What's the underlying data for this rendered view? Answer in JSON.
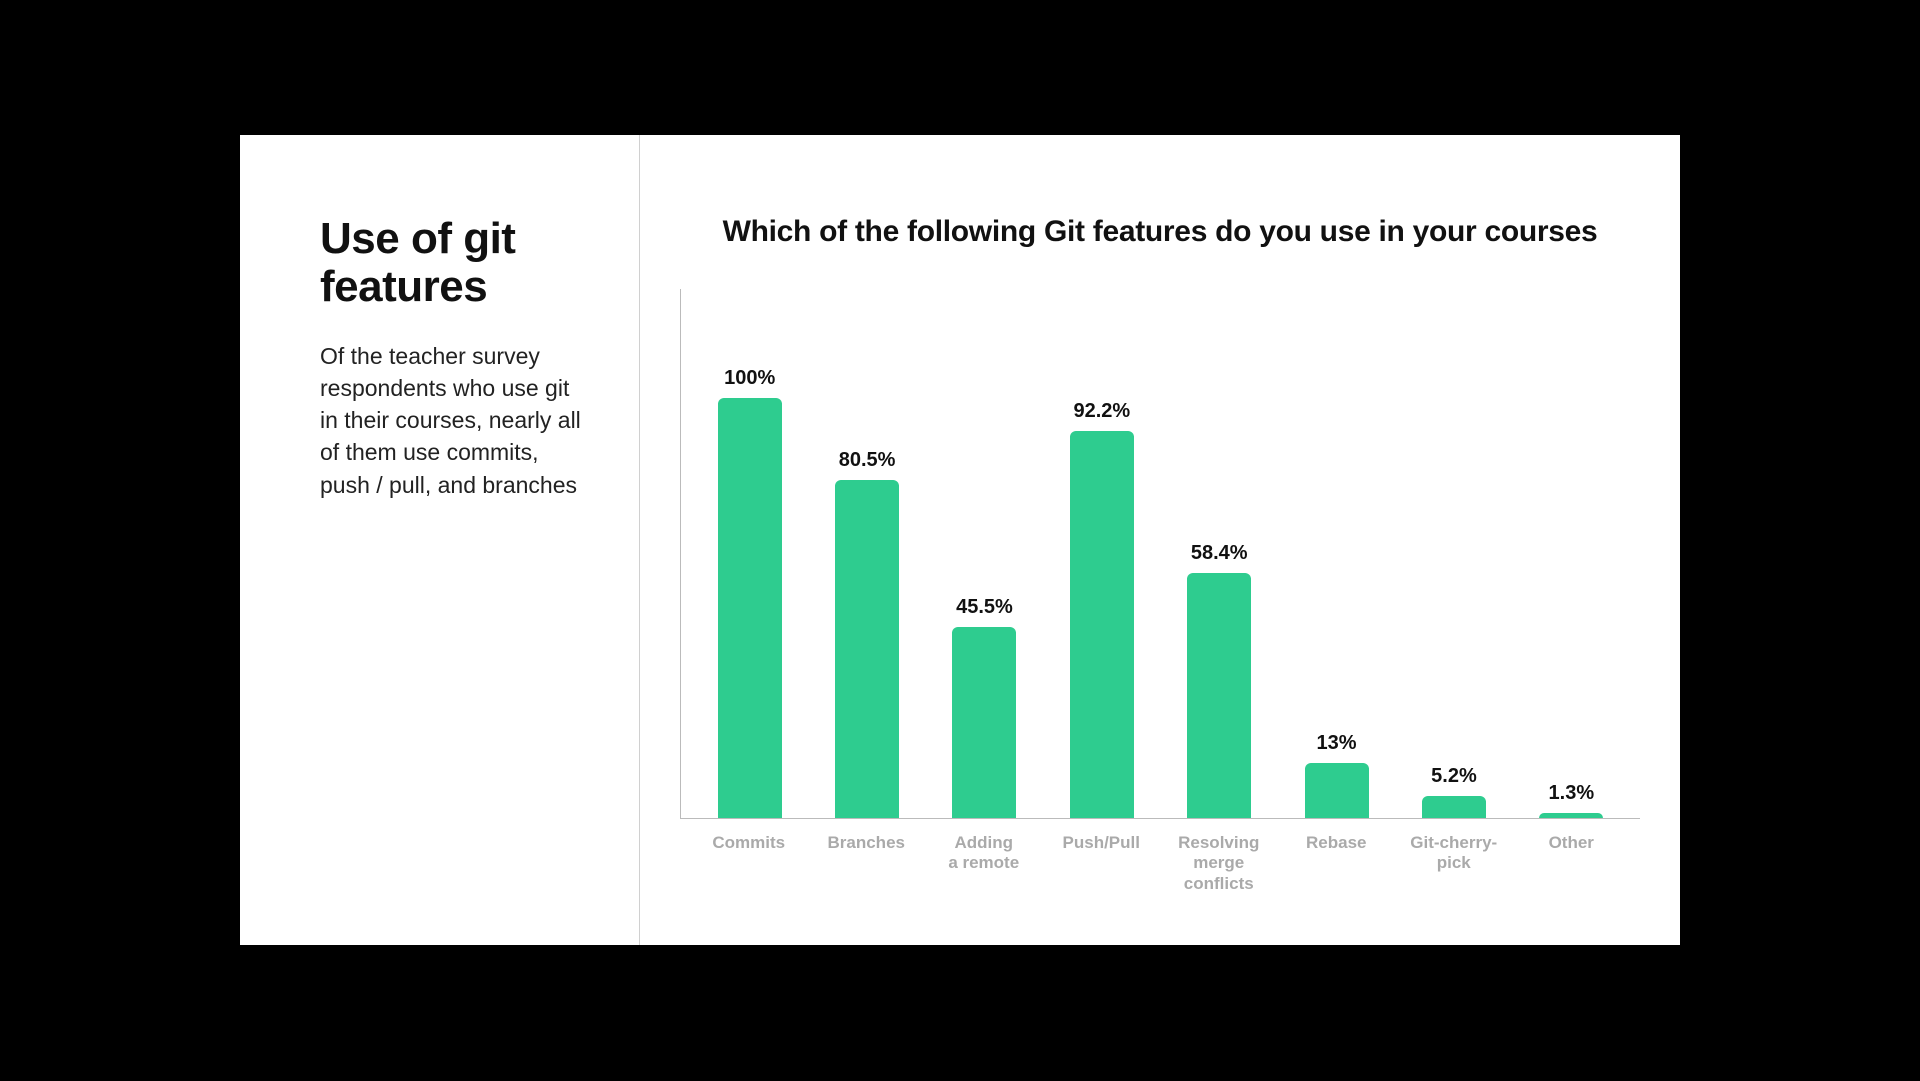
{
  "left": {
    "title": "Use of git features",
    "description": "Of the teacher survey respondents who use git in their courses, nearly all of them use commits, push / pull, and branches"
  },
  "chart_data": {
    "type": "bar",
    "title": "Which of the following Git features do you use in your courses",
    "categories": [
      "Commits",
      "Branches",
      "Adding\na remote",
      "Push/Pull",
      "Resolving\nmerge conflicts",
      "Rebase",
      "Git-cherry-pick",
      "Other"
    ],
    "values": [
      100,
      80.5,
      45.5,
      92.2,
      58.4,
      13,
      5.2,
      1.3
    ],
    "value_labels": [
      "100%",
      "80.5%",
      "92.2%",
      "58.4%",
      "13%",
      "5.2%",
      "1.3%",
      "45.5%"
    ],
    "labels_ordered": [
      "100%",
      "80.5%",
      "45.5%",
      "92.2%",
      "58.4%",
      "13%",
      "5.2%",
      "1.3%"
    ],
    "ylim": [
      0,
      100
    ],
    "bar_color": "#2ecc8f",
    "xlabel": "",
    "ylabel": ""
  }
}
